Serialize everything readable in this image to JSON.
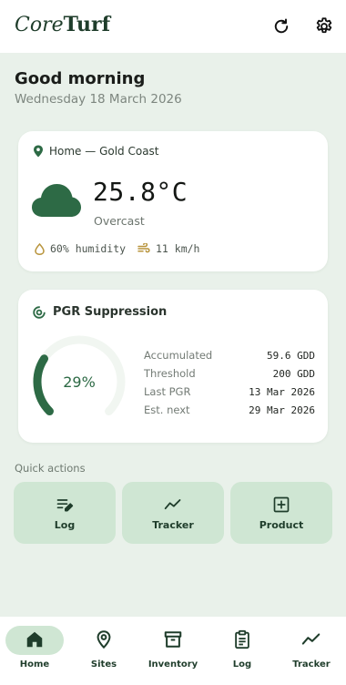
{
  "app": {
    "logo_core": "Core",
    "logo_turf": "Turf"
  },
  "header": {
    "greeting": "Good morning",
    "date": "Wednesday 18 March 2026"
  },
  "weather": {
    "location": "Home — Gold Coast",
    "temperature": "25.8°C",
    "condition": "Overcast",
    "humidity": "60% humidity",
    "wind": "11 km/h"
  },
  "pgr": {
    "title": "PGR Suppression",
    "percent_label": "29%",
    "percent_value": 0.29,
    "rows": [
      {
        "label": "Accumulated",
        "value": "59.6 GDD"
      },
      {
        "label": "Threshold",
        "value": "200 GDD"
      },
      {
        "label": "Last PGR",
        "value": "13 Mar 2026"
      },
      {
        "label": "Est. next",
        "value": "29 Mar 2026"
      }
    ]
  },
  "quick_actions": {
    "label": "Quick actions",
    "items": [
      {
        "label": "Log",
        "icon": "edit-list-icon"
      },
      {
        "label": "Tracker",
        "icon": "trend-icon"
      },
      {
        "label": "Product",
        "icon": "add-box-icon"
      }
    ]
  },
  "nav": {
    "active": "Home",
    "items": [
      {
        "label": "Home",
        "icon": "home-icon"
      },
      {
        "label": "Sites",
        "icon": "location-pin-icon"
      },
      {
        "label": "Inventory",
        "icon": "archive-box-icon"
      },
      {
        "label": "Log",
        "icon": "clipboard-icon"
      },
      {
        "label": "Tracker",
        "icon": "trend-icon"
      }
    ]
  },
  "colors": {
    "primary": "#2d6a45",
    "accent_tint": "#cfe6d3",
    "background": "#e9f1ea"
  }
}
